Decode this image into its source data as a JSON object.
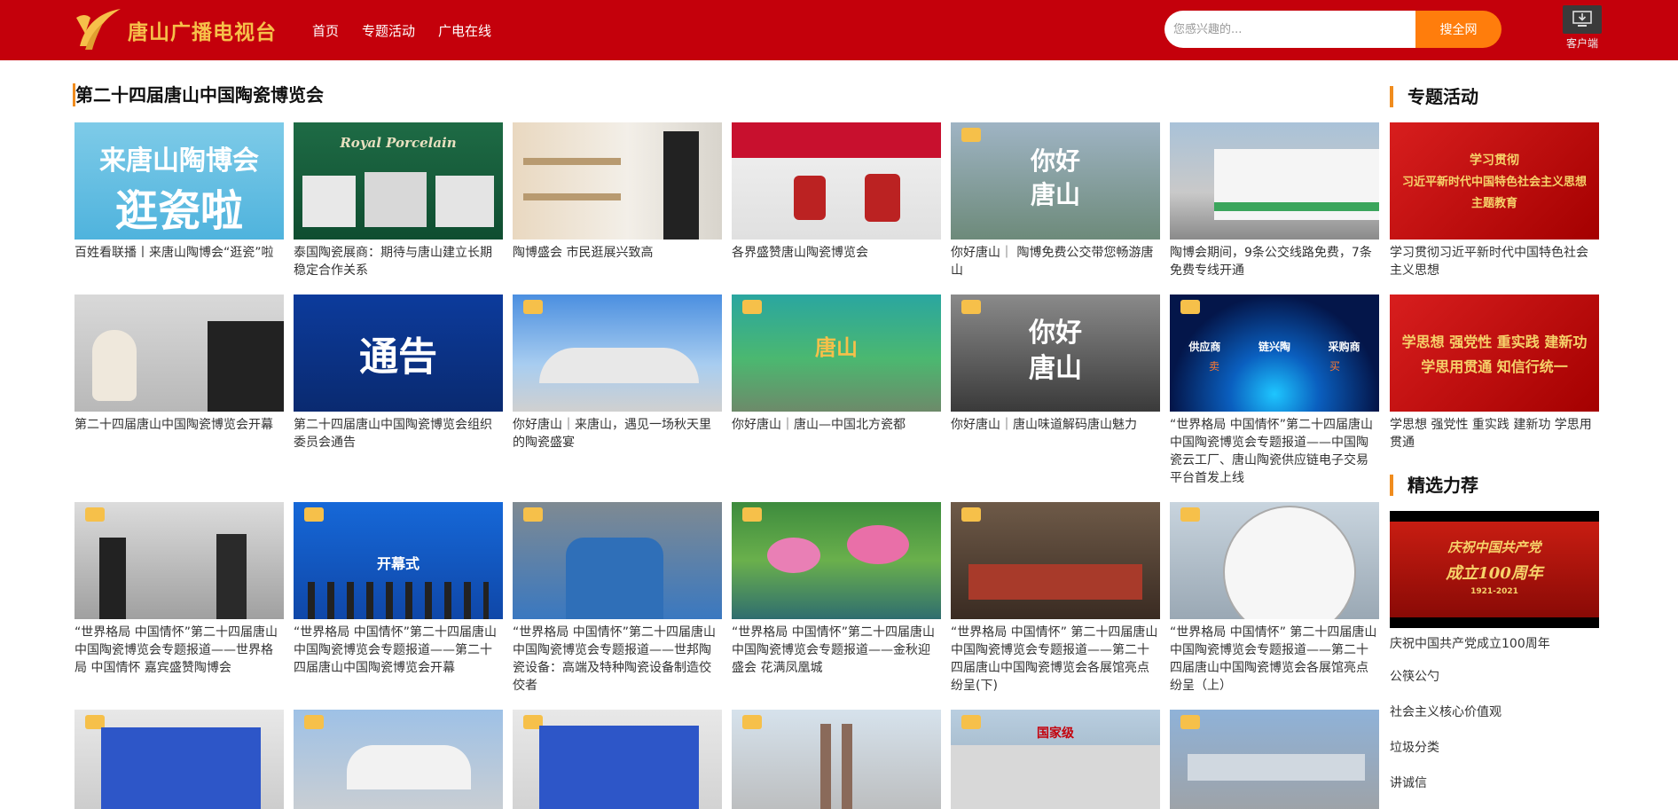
{
  "header": {
    "logo_text": "唐山广播电视台",
    "nav": [
      "首页",
      "专题活动",
      "广电在线"
    ],
    "search_placeholder": "您感兴趣的...",
    "search_button": "搜全网",
    "client_label": "客户端",
    "colors": {
      "bar": "#c4000b",
      "logo": "#f6c04a",
      "search_button": "#ff7d0c"
    }
  },
  "main": {
    "title": "第二十四届唐山中国陶瓷博览会",
    "rows": [
      {
        "items": [
          {
            "caption": "百姓看联播丨来唐山陶博会“逛瓷”啦",
            "thumb_text": [
              "来唐山陶博会",
              "逛瓷啦"
            ]
          },
          {
            "caption": "泰国陶瓷展商：期待与唐山建立长期稳定合作关系",
            "thumb_text": [
              "Royal Porcelain"
            ]
          },
          {
            "caption": "陶博盛会 市民逛展兴致高",
            "thumb_text": []
          },
          {
            "caption": "各界盛赞唐山陶瓷博览会",
            "thumb_text": []
          },
          {
            "caption": "你好唐山｜ 陶博免费公交带您畅游唐山",
            "thumb_text": [
              "你好",
              "唐山"
            ]
          },
          {
            "caption": "陶博会期间，9条公交线路免费，7条免费专线开通",
            "thumb_text": []
          }
        ]
      },
      {
        "items": [
          {
            "caption": "第二十四届唐山中国陶瓷博览会开幕",
            "thumb_text": []
          },
          {
            "caption": "第二十四届唐山中国陶瓷博览会组织委员会通告",
            "thumb_text": [
              "通告"
            ]
          },
          {
            "caption": "你好唐山｜来唐山，遇见一场秋天里的陶瓷盛宴",
            "thumb_text": []
          },
          {
            "caption": "你好唐山｜唐山—中国北方瓷都",
            "thumb_text": [
              "唐山"
            ]
          },
          {
            "caption": "你好唐山｜唐山味道解码唐山魅力",
            "thumb_text": [
              "你好",
              "唐山"
            ]
          },
          {
            "caption": "“世界格局 中国情怀”第二十四届唐山中国陶瓷博览会专题报道——中国陶瓷云工厂、唐山陶瓷供应链电子交易平台首发上线",
            "thumb_text": [
              "供应商",
              "链兴陶",
              "采购商",
              "卖",
              "买"
            ]
          }
        ]
      },
      {
        "items": [
          {
            "caption": "“世界格局 中国情怀”第二十四届唐山中国陶瓷博览会专题报道——世界格局 中国情怀 嘉宾盛赞陶博会",
            "thumb_text": []
          },
          {
            "caption": "“世界格局 中国情怀”第二十四届唐山中国陶瓷博览会专题报道——第二十四届唐山中国陶瓷博览会开幕",
            "thumb_text": [
              "开幕式"
            ]
          },
          {
            "caption": "“世界格局 中国情怀”第二十四届唐山中国陶瓷博览会专题报道——世邦陶瓷设备：高端及特种陶瓷设备制造佼佼者",
            "thumb_text": []
          },
          {
            "caption": "“世界格局 中国情怀”第二十四届唐山中国陶瓷博览会专题报道——金秋迎盛会 花满凤凰城",
            "thumb_text": []
          },
          {
            "caption": "“世界格局 中国情怀” 第二十四届唐山中国陶瓷博览会专题报道——第二十四届唐山中国陶瓷博览会各展馆亮点纷呈(下)",
            "thumb_text": []
          },
          {
            "caption": "“世界格局 中国情怀” 第二十四届唐山中国陶瓷博览会专题报道——第二十四届唐山中国陶瓷博览会各展馆亮点纷呈（上）",
            "thumb_text": []
          }
        ]
      },
      {
        "items": [
          {
            "caption": "",
            "thumb_text": []
          },
          {
            "caption": "",
            "thumb_text": []
          },
          {
            "caption": "",
            "thumb_text": []
          },
          {
            "caption": "",
            "thumb_text": []
          },
          {
            "caption": "",
            "thumb_text": [
              "国家级"
            ]
          },
          {
            "caption": "",
            "thumb_text": []
          }
        ]
      }
    ]
  },
  "sidebar": {
    "topic_title": "专题活动",
    "topic_items": [
      {
        "caption": "学习贯彻习近平新时代中国特色社会主义思想",
        "thumb_text": [
          "学习贯彻",
          "习近平新时代中国特色社会主义思想",
          "主题教育"
        ]
      },
      {
        "caption": "学思想 强党性 重实践 建新功 学思用贯通",
        "thumb_text": [
          "学思想 强党性 重实践 建新功",
          "学思用贯通 知信行统一"
        ]
      }
    ],
    "picks_title": "精选力荐",
    "picks_feature": {
      "caption": "庆祝中国共产党成立100周年",
      "thumb_text": [
        "庆祝中国共产党",
        "成立100周年",
        "1921-2021"
      ]
    },
    "picks_links": [
      "公筷公勺",
      "社会主义核心价值观",
      "垃圾分类",
      "讲诚信"
    ]
  }
}
